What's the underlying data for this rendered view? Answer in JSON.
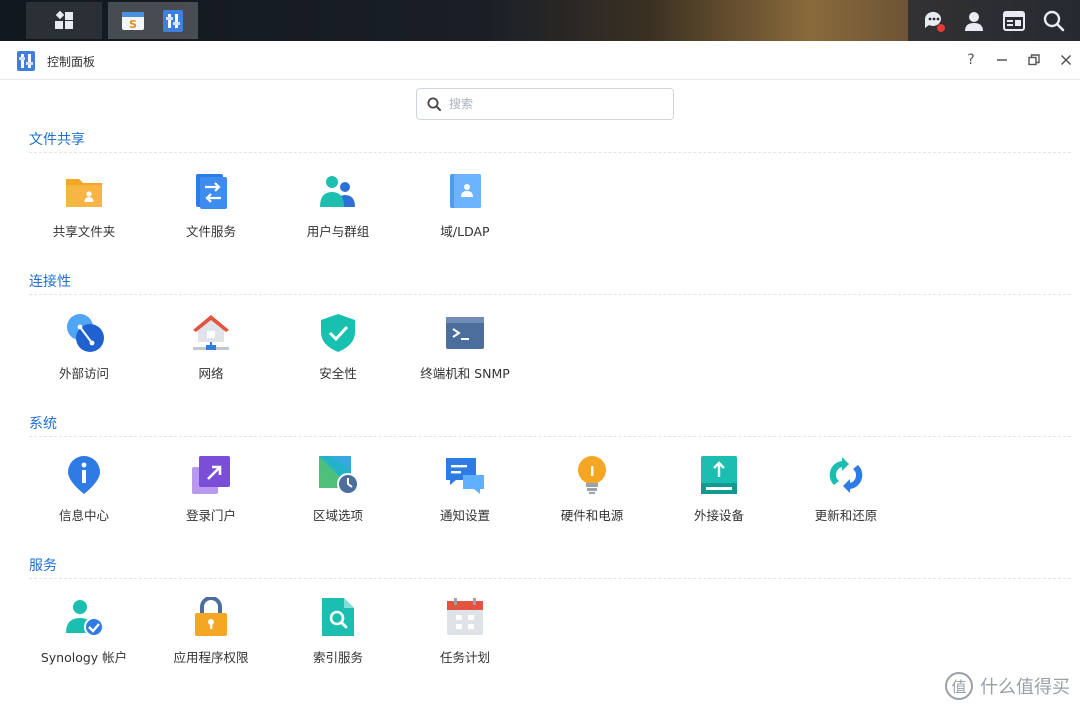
{
  "window": {
    "title": "控制面板"
  },
  "search": {
    "placeholder": "搜索"
  },
  "sections": [
    {
      "title": "文件共享",
      "items": [
        "共享文件夹",
        "文件服务",
        "用户与群组",
        "域/LDAP"
      ]
    },
    {
      "title": "连接性",
      "items": [
        "外部访问",
        "网络",
        "安全性",
        "终端机和 SNMP"
      ]
    },
    {
      "title": "系统",
      "items": [
        "信息中心",
        "登录门户",
        "区域选项",
        "通知设置",
        "硬件和电源",
        "外接设备",
        "更新和还原"
      ]
    },
    {
      "title": "服务",
      "items": [
        "Synology 帐户",
        "应用程序权限",
        "索引服务",
        "任务计划"
      ]
    }
  ],
  "watermark": {
    "text": "什么值得买"
  },
  "colors": {
    "accent": "#1f6fd1"
  }
}
